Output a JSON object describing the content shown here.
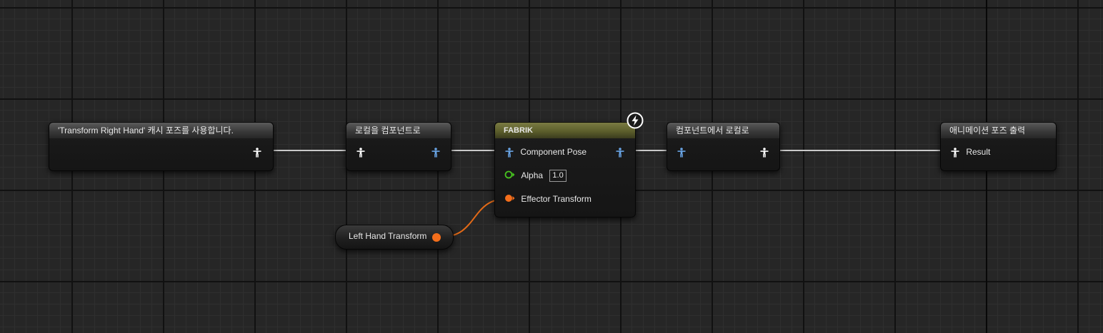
{
  "graph": {
    "background": "#262626",
    "wire_exec_color": "#c9c9c9",
    "wire_transform_color": "#e36a17"
  },
  "nodes": {
    "cached_pose": {
      "title": "'Transform Right Hand' 캐시 포즈를 사용합니다.",
      "output_icon": "pose-icon-white"
    },
    "local_to_component": {
      "title": "로컬을 컴포넌트로",
      "input_icon": "pose-icon-white",
      "output_icon": "pose-icon-blue"
    },
    "fabrik": {
      "title": "FABRIK",
      "header_color": "#6b6c36",
      "badge_icon": "lightning-icon",
      "pins": {
        "component_pose": "Component Pose",
        "alpha_label": "Alpha",
        "alpha_value": "1.0",
        "effector_transform": "Effector Transform"
      }
    },
    "component_to_local": {
      "title": "컴포넌트에서 로컬로",
      "input_icon": "pose-icon-blue",
      "output_icon": "pose-icon-white"
    },
    "output_pose": {
      "title": "애니메이션 포즈 출력",
      "result_label": "Result"
    },
    "left_hand_transform": {
      "label": "Left Hand Transform",
      "pin_color": "#f46e1b"
    }
  },
  "icons": {
    "pose_white": "#ffffff",
    "pose_blue": "#6aa6e8",
    "alpha_pin": "#47c21f",
    "effector_pin": "#f46e1b"
  }
}
